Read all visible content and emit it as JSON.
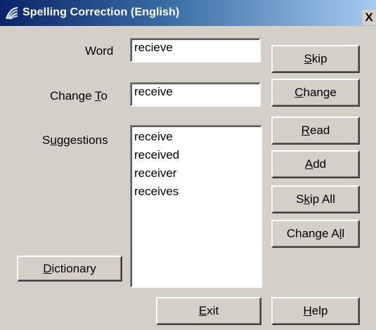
{
  "window": {
    "title": "Spelling Correction (English)",
    "close_label": "X"
  },
  "labels": {
    "word": "Word",
    "change_to_pre": "Change ",
    "change_to_key": "T",
    "change_to_post": "o",
    "suggestions_pre": "S",
    "suggestions_key": "u",
    "suggestions_post": "ggestions"
  },
  "fields": {
    "word_value": "recieve",
    "change_to_value": "receive"
  },
  "suggestions": [
    "receive",
    "received",
    "receiver",
    "receives"
  ],
  "buttons": {
    "skip": {
      "key": "S",
      "rest": "kip"
    },
    "change": {
      "key": "C",
      "rest": "hange"
    },
    "read": {
      "key": "R",
      "rest": "ead"
    },
    "add": {
      "key": "A",
      "rest": "dd"
    },
    "skip_all": {
      "pre": "S",
      "key": "k",
      "rest": "ip All"
    },
    "change_all": {
      "pre": "Change A",
      "key": "l",
      "rest": "l"
    },
    "dictionary": {
      "key": "D",
      "rest": "ictionary"
    },
    "exit": {
      "key": "E",
      "rest": "xit"
    },
    "help": {
      "key": "H",
      "rest": "elp"
    }
  },
  "icons": {
    "title_icon": "spelling-app-icon",
    "close_icon": "close-icon"
  },
  "colors": {
    "titlebar_start": "#0a246a",
    "titlebar_end": "#a6caf0",
    "face": "#d4d0c8"
  }
}
